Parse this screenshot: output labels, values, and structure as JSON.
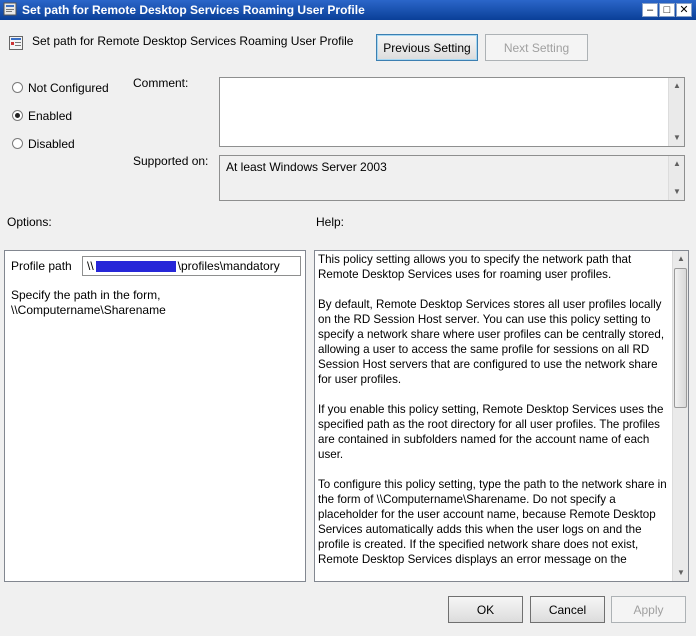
{
  "window": {
    "title": "Set path for Remote Desktop Services Roaming User Profile",
    "controls": {
      "minimize": "–",
      "maximize": "□",
      "close": "✕"
    }
  },
  "header": {
    "policy_title": "Set path for Remote Desktop Services Roaming User Profile",
    "previous_label": "Previous Setting",
    "next_label": "Next Setting"
  },
  "state": {
    "options": [
      {
        "label": "Not Configured",
        "selected": false
      },
      {
        "label": "Enabled",
        "selected": true
      },
      {
        "label": "Disabled",
        "selected": false
      }
    ]
  },
  "comment": {
    "label": "Comment:",
    "value": ""
  },
  "supported": {
    "label": "Supported on:",
    "value": "At least Windows Server 2003"
  },
  "options_section": {
    "heading": "Options:",
    "profile_label": "Profile path",
    "profile_prefix": "\\\\",
    "profile_suffix": "\\profiles\\mandatory",
    "hint_line1": "Specify the path in the form,",
    "hint_line2": "\\\\Computername\\Sharename"
  },
  "help_section": {
    "heading": "Help:",
    "paragraphs": [
      "This policy setting allows you to specify the network path that Remote Desktop Services uses for roaming user profiles.",
      "By default, Remote Desktop Services stores all user profiles locally on the RD Session Host server. You can use this policy setting to specify a network share where user profiles can be centrally stored, allowing a user to access the same profile for sessions on all RD Session Host servers that are configured to use the network share for user profiles.",
      "If you enable this policy setting, Remote Desktop Services uses the specified path as the root directory for all user profiles. The profiles are contained in subfolders named for the account name of each user.",
      "To configure this policy setting, type the path to the network share in the form of \\\\Computername\\Sharename. Do not specify a placeholder for the user account name, because Remote Desktop Services automatically adds this when the user logs on and the profile is created. If the specified network share does not exist, Remote Desktop Services displays an error message on the"
    ]
  },
  "footer": {
    "ok_label": "OK",
    "cancel_label": "Cancel",
    "apply_label": "Apply"
  },
  "colors": {
    "titlebar": "#0a3f98",
    "redaction": "#2727d8",
    "background": "#f0f0f0"
  }
}
